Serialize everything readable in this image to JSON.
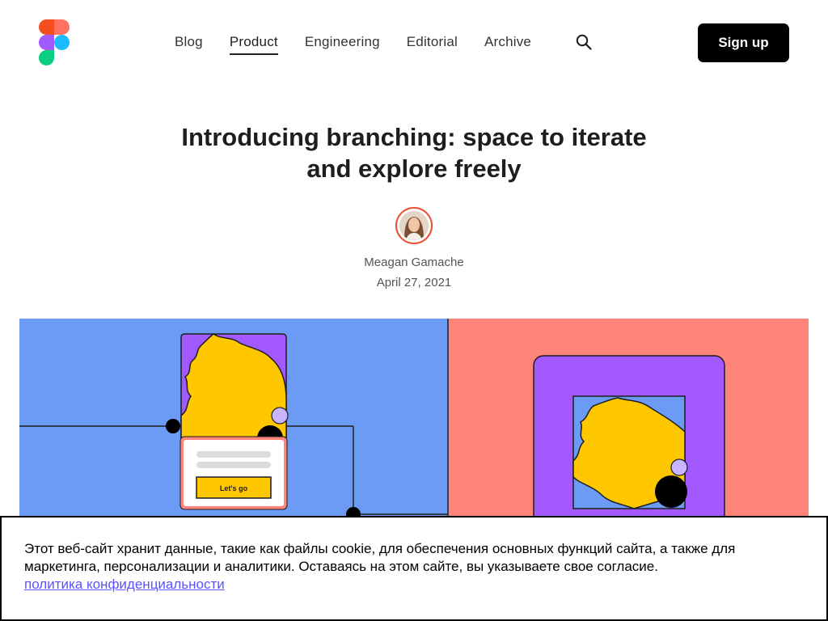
{
  "header": {
    "nav": [
      "Blog",
      "Product",
      "Engineering",
      "Editorial",
      "Archive"
    ],
    "active_nav": "Product",
    "signup_label": "Sign up"
  },
  "article": {
    "title_line1": "Introducing branching: space to iterate",
    "title_line2": "and explore freely",
    "author": "Meagan Gamache",
    "date": "April 27, 2021"
  },
  "hero": {
    "button_label": "Let's go",
    "colors": {
      "left_bg": "#6b9bf5",
      "right_bg": "#ff857a",
      "purple": "#a259ff",
      "yellow": "#ffc700"
    }
  },
  "cookie": {
    "text": "Этот веб-сайт хранит данные, такие как файлы cookie, для обеспечения основных функций сайта, а также для маркетинга, персонализации и аналитики. Оставаясь на этом сайте, вы указываете свое согласие.",
    "link": "политика конфиденциальности"
  },
  "icons": [
    "figma-logo",
    "search-icon",
    "author-avatar"
  ]
}
